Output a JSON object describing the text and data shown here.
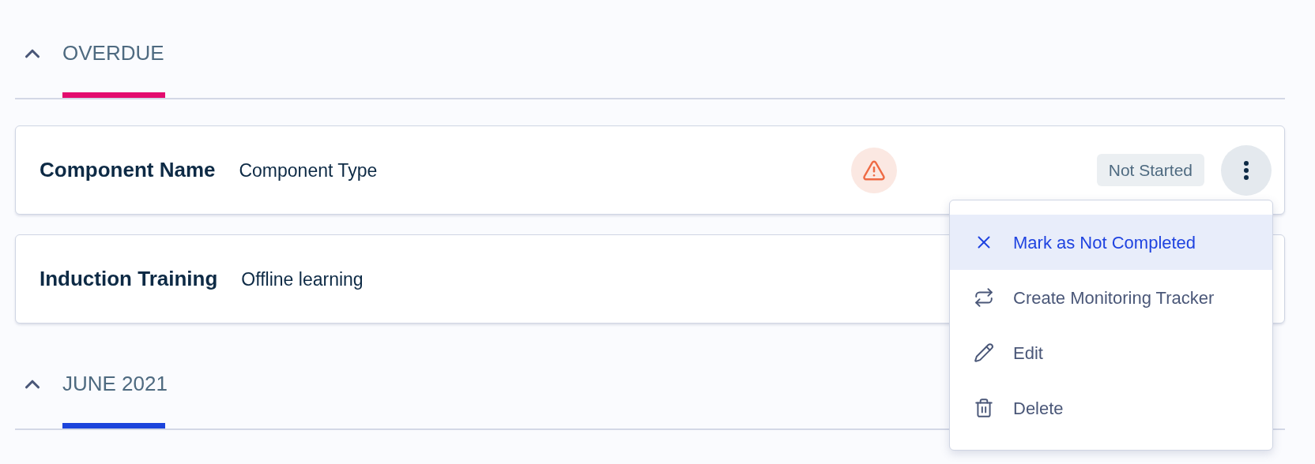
{
  "sections": [
    {
      "label": "OVERDUE",
      "expanded": true,
      "color": "#e30b6e",
      "items": [
        {
          "name": "Component Name",
          "type": "Component Type",
          "warning": true,
          "status": "Not Started",
          "menu_open": true
        },
        {
          "name": "Induction Training",
          "type": "Offline learning"
        }
      ]
    },
    {
      "label": "JUNE 2021",
      "expanded": true,
      "color": "#1c44dc"
    }
  ],
  "menu": {
    "items": [
      {
        "kind": "close",
        "label": "Mark as Not Completed",
        "selected": true
      },
      {
        "kind": "repeat",
        "label": "Create Monitoring Tracker",
        "selected": false
      },
      {
        "kind": "edit",
        "label": "Edit",
        "selected": false
      },
      {
        "kind": "delete",
        "label": "Delete",
        "selected": false
      }
    ]
  }
}
